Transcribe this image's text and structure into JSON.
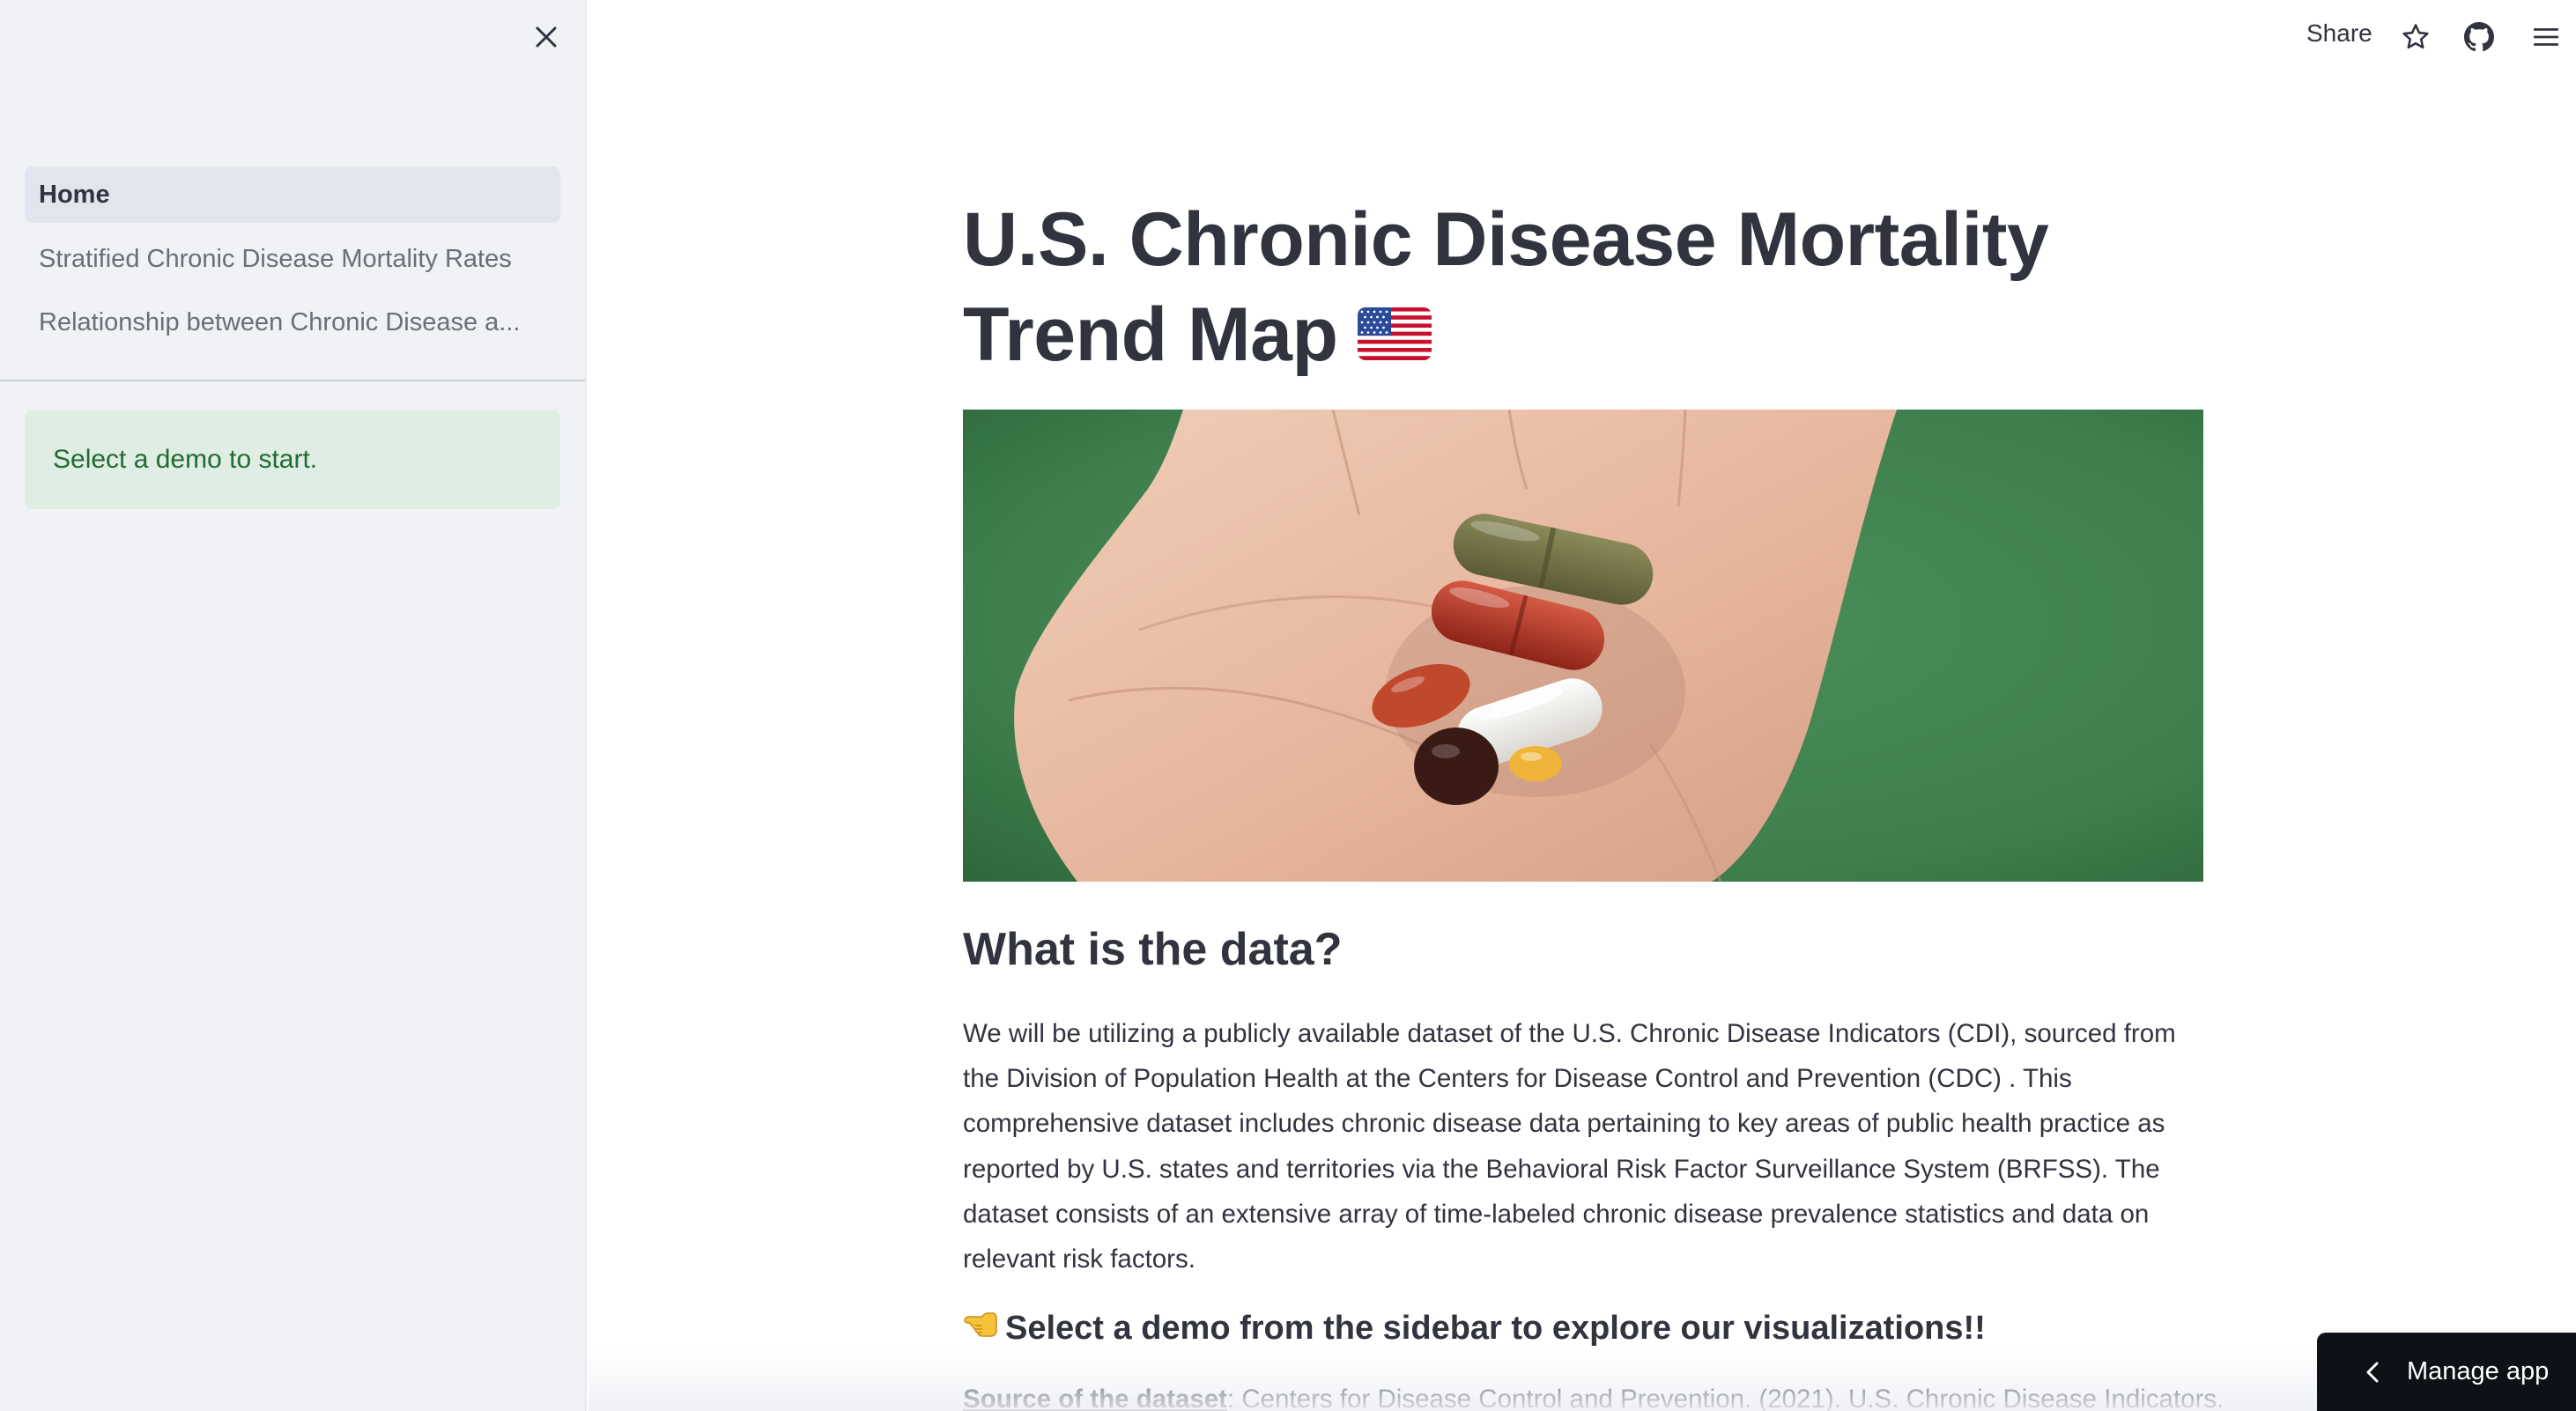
{
  "sidebar": {
    "nav": [
      {
        "label": "Home",
        "active": true
      },
      {
        "label": "Stratified Chronic Disease Mortality Rates",
        "active": false
      },
      {
        "label": "Relationship between Chronic Disease a...",
        "active": false
      }
    ],
    "info_message": "Select a demo to start.",
    "close_icon": "close-icon"
  },
  "header": {
    "share_label": "Share",
    "icons": [
      "star-icon",
      "github-icon",
      "hamburger-menu-icon"
    ]
  },
  "main": {
    "title": "U.S. Chronic Disease Mortality Trend Map",
    "title_emoji": "flag-usa-icon",
    "hero_image": "hand-holding-pills-image",
    "section_heading": "What is the data?",
    "paragraph": "We will be utilizing a publicly available dataset of the U.S. Chronic Disease Indicators (CDI), sourced from the Division of Population Health at the Centers for Disease Control and Prevention (CDC) . This comprehensive dataset includes chronic disease data pertaining to key areas of public health practice as reported by U.S. states and territories via the Behavioral Risk Factor Surveillance System (BRFSS). The dataset consists of an extensive array of time-labeled chronic disease prevalence statistics and data on relevant risk factors.",
    "cta": "Select a demo from the sidebar to explore our visualizations!!",
    "cta_emoji": "pointing-left-hand-icon",
    "source_label": "Source of the dataset",
    "source_text": ": Centers for Disease Control and Prevention. (2021). U.S. Chronic Disease Indicators."
  },
  "manage_app": {
    "label": "Manage app"
  },
  "colors": {
    "sidebar_bg": "#f0f2f6",
    "active_nav_bg": "#e1e5ee",
    "info_bg": "#dfede3",
    "info_text": "#1f6b32",
    "manage_bg": "#0e1117",
    "text": "#31333f"
  }
}
